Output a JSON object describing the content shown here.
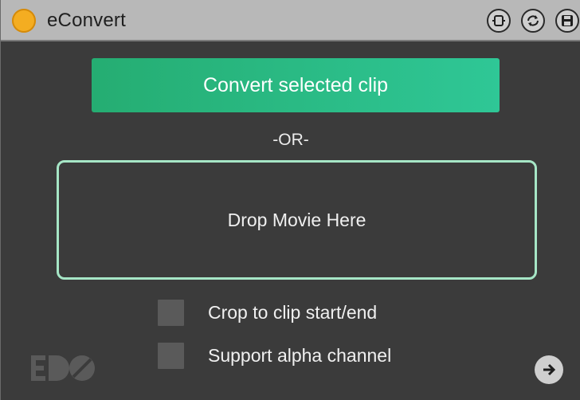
{
  "window": {
    "title": "eConvert"
  },
  "titlebar": {
    "buttons": [
      {
        "name": "view-toggle-icon"
      },
      {
        "name": "sync-icon"
      },
      {
        "name": "save-icon"
      }
    ]
  },
  "main": {
    "convert_button": "Convert selected clip",
    "or_label": "-OR-",
    "drop_zone": "Drop Movie Here",
    "options": [
      {
        "label": "Crop to clip start/end",
        "checked": false
      },
      {
        "label": "Support alpha channel",
        "checked": false
      }
    ]
  },
  "footer": {
    "logo": "edo-logo",
    "next_icon": "arrow-right-icon"
  },
  "colors": {
    "accent_start": "#25ad72",
    "accent_end": "#2fc796",
    "drop_border": "#a6e6c6",
    "power_led": "#f4ad21",
    "background": "#3b3b3b"
  }
}
